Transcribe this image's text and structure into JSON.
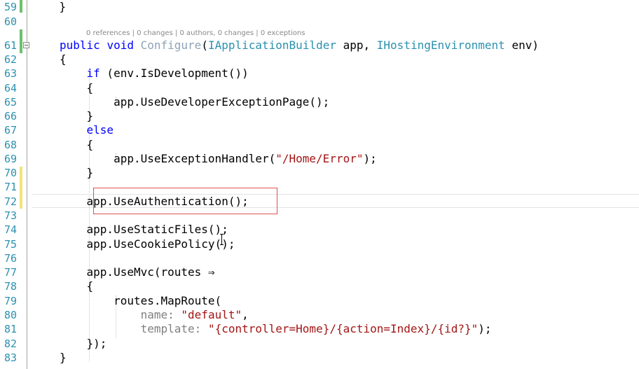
{
  "lines": [
    {
      "n": "59",
      "code": "    }"
    },
    {
      "n": "60",
      "code": ""
    },
    {
      "n": "61",
      "code": "public void Configure(IApplicationBuilder app, IHostingEnvironment env)"
    },
    {
      "n": "62",
      "code": "{"
    },
    {
      "n": "63",
      "code": "    if (env.IsDevelopment())"
    },
    {
      "n": "64",
      "code": "    {"
    },
    {
      "n": "65",
      "code": "        app.UseDeveloperExceptionPage();"
    },
    {
      "n": "66",
      "code": "    }"
    },
    {
      "n": "67",
      "code": "    else"
    },
    {
      "n": "68",
      "code": "    {"
    },
    {
      "n": "69",
      "code": "        app.UseExceptionHandler(\"/Home/Error\");"
    },
    {
      "n": "70",
      "code": "    }"
    },
    {
      "n": "71",
      "code": ""
    },
    {
      "n": "72",
      "code": "    app.UseAuthentication();"
    },
    {
      "n": "73",
      "code": ""
    },
    {
      "n": "74",
      "code": "    app.UseStaticFiles();"
    },
    {
      "n": "75",
      "code": "    app.UseCookiePolicy();"
    },
    {
      "n": "76",
      "code": ""
    },
    {
      "n": "77",
      "code": "    app.UseMvc(routes ⇒"
    },
    {
      "n": "78",
      "code": "    {"
    },
    {
      "n": "79",
      "code": "        routes.MapRoute("
    },
    {
      "n": "80",
      "code": "            name: \"default\","
    },
    {
      "n": "81",
      "code": "            template: \"{controller=Home}/{action=Index}/{id?}\");"
    },
    {
      "n": "82",
      "code": "    });"
    },
    {
      "n": "83",
      "code": "}"
    }
  ],
  "codelens": "0 references | 0 changes | 0 authors, 0 changes | 0 exceptions",
  "tokens": {
    "kw_public": "public",
    "kw_void": "void",
    "method_configure": "Configure",
    "paren_open": "(",
    "type_app_builder": "IApplicationBuilder",
    "arg_app": " app, ",
    "type_hosting_env": "IHostingEnvironment",
    "arg_env": " env)",
    "kw_if": "if",
    "if_cond": " (env.IsDevelopment())",
    "kw_else": "else",
    "call_exception_handler": "app.UseExceptionHandler(",
    "str_home_error": "\"/Home/Error\"",
    "end_call": ");",
    "param_name": "name:",
    "str_default": "\"default\"",
    "comma": ",",
    "param_template": "template:",
    "str_template": "\"{controller=Home}/{action=Index}/{id?}\""
  },
  "colors": {
    "keyword": "#0000ff",
    "type": "#2b91af",
    "string": "#a31515",
    "line_number": "#2b91af",
    "change_saved": "#6cc16c",
    "change_unsaved": "#f3e27a",
    "highlight_box": "#d9534f"
  }
}
